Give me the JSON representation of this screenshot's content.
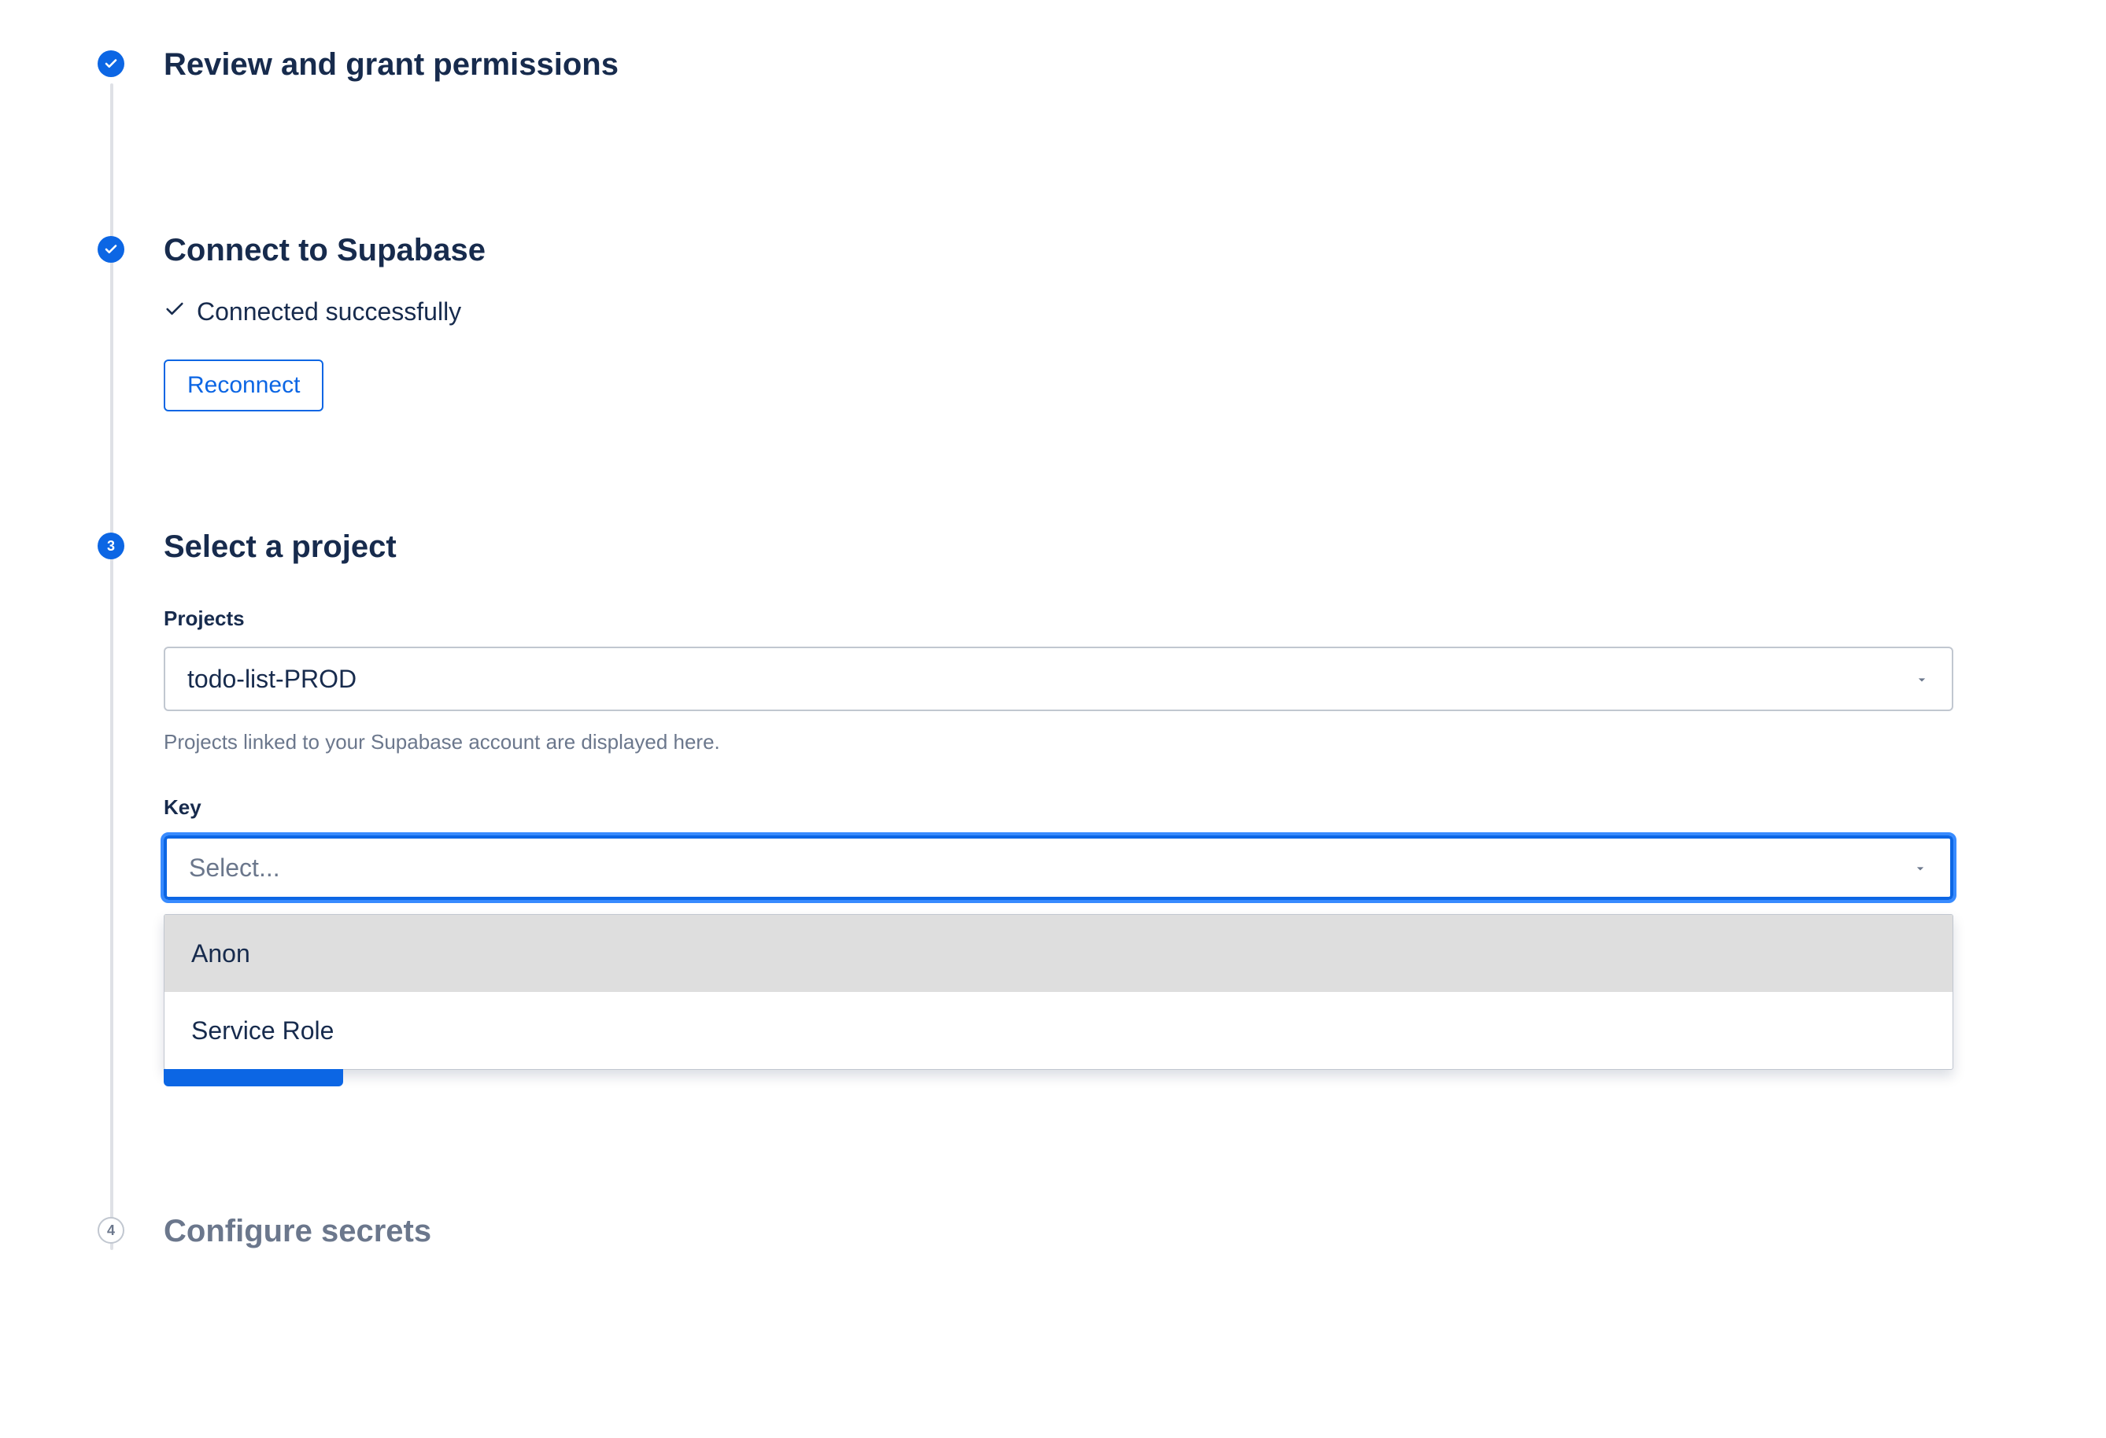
{
  "steps": {
    "s1": {
      "title": "Review and grant permissions"
    },
    "s2": {
      "title": "Connect to Supabase",
      "status_text": "Connected successfully",
      "reconnect_label": "Reconnect"
    },
    "s3": {
      "number": "3",
      "title": "Select a project",
      "projects_label": "Projects",
      "projects_value": "todo-list-PROD",
      "projects_help": "Projects linked to your Supabase account are displayed here.",
      "key_label": "Key",
      "key_placeholder": "Select...",
      "key_options": [
        "Anon",
        "Service Role"
      ]
    },
    "s4": {
      "number": "4",
      "title": "Configure secrets"
    }
  },
  "icons": {
    "check": "check-icon",
    "caret": "▾"
  },
  "colors": {
    "accent": "#0c66e4",
    "focus_ring": "#388bff",
    "text": "#172b4d",
    "muted": "#6b778c",
    "border": "#c1c7d0",
    "option_highlight": "#dedede"
  }
}
